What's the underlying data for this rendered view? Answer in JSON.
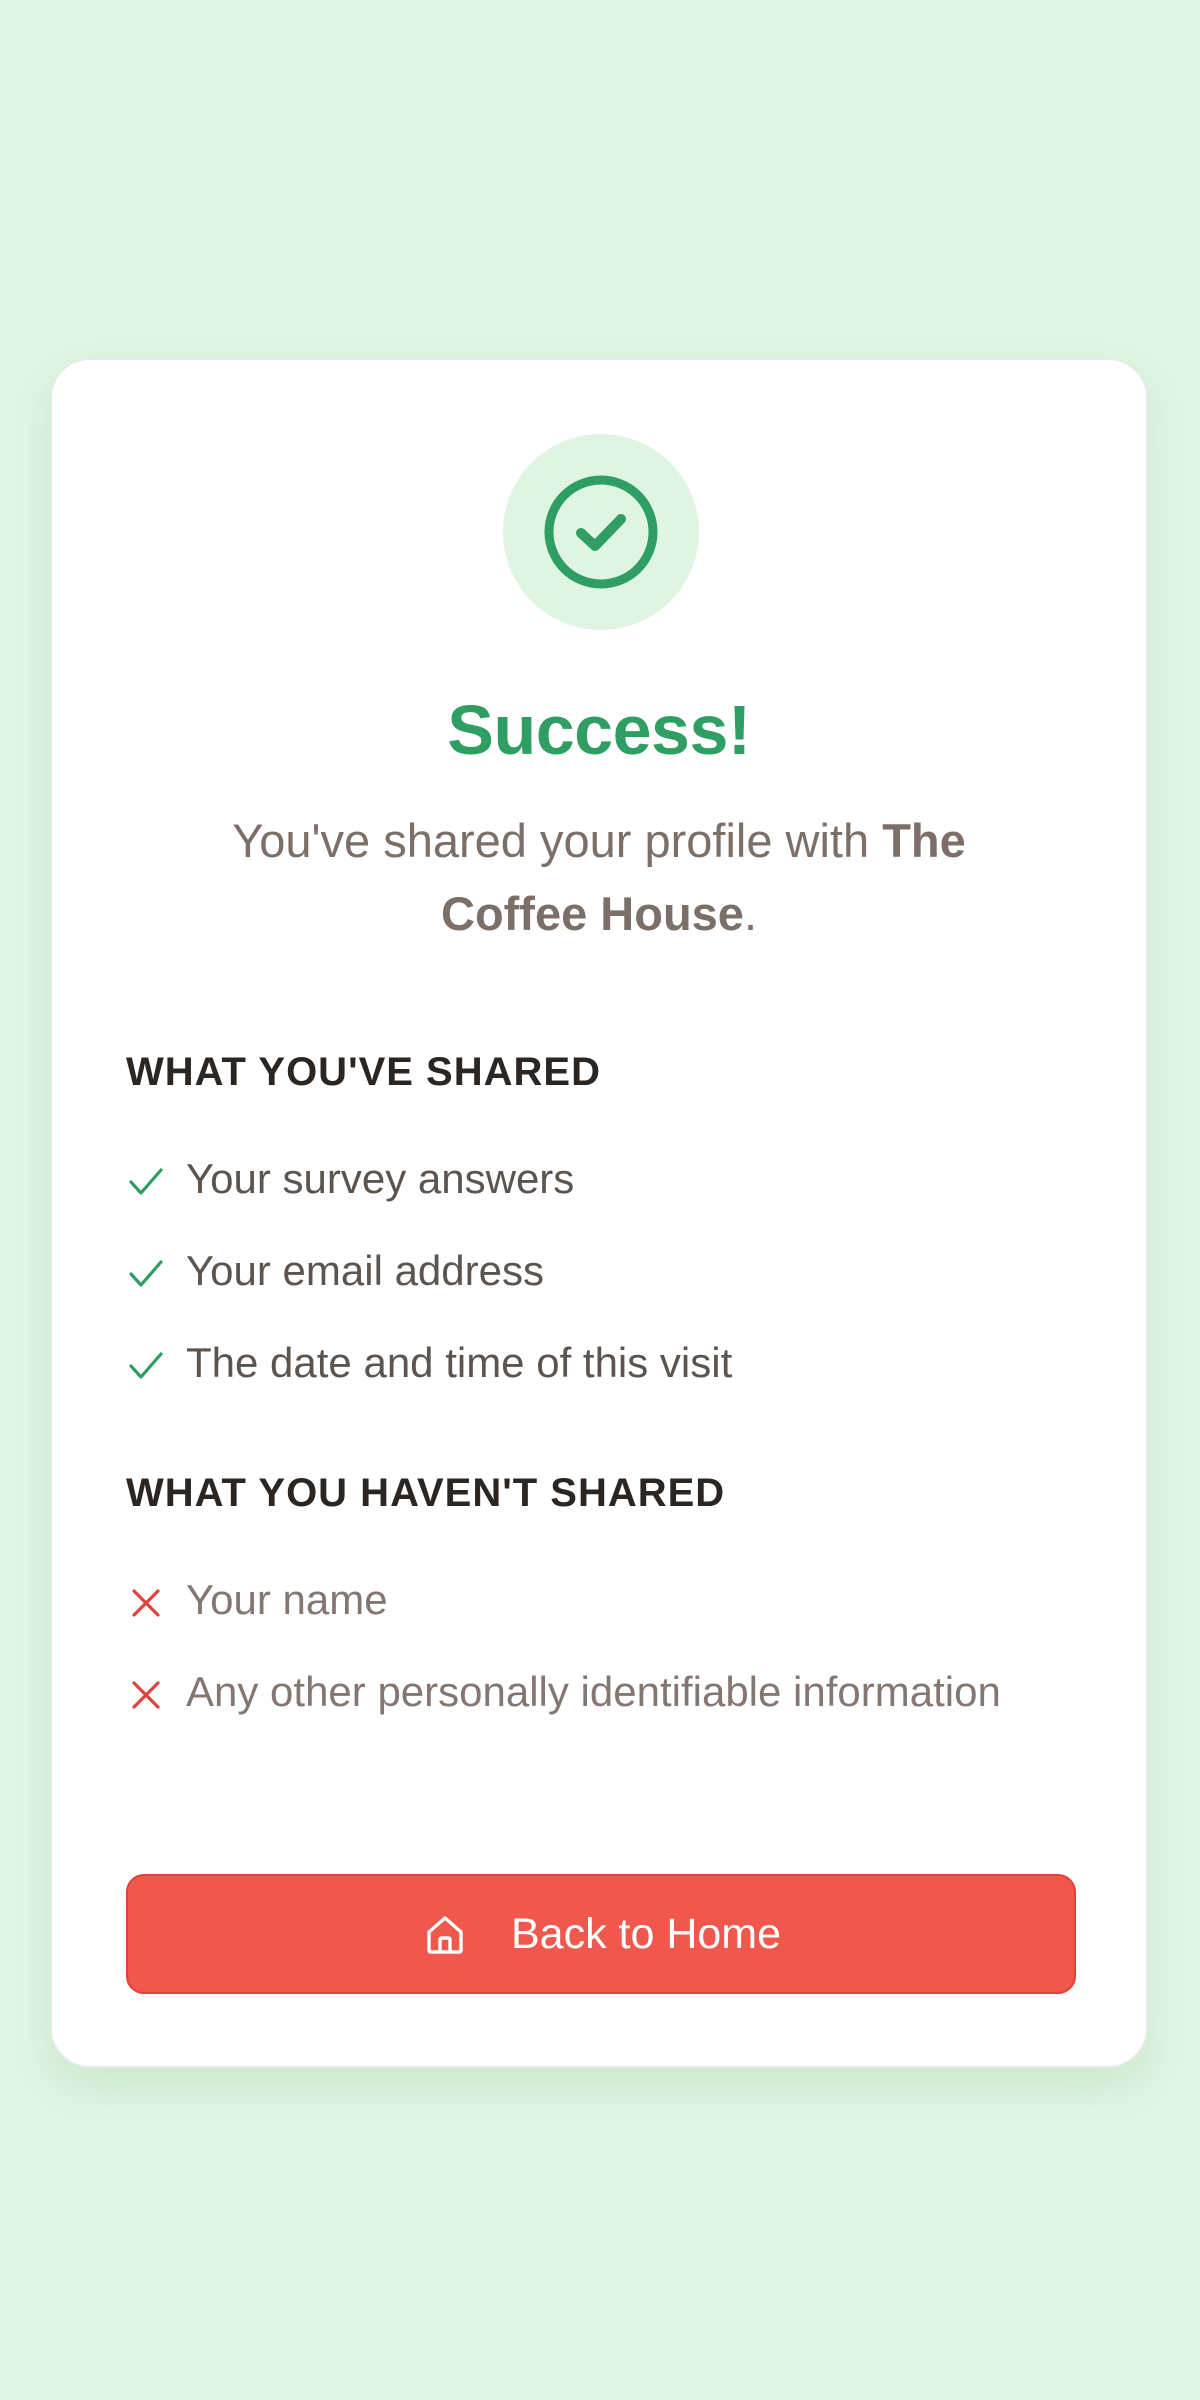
{
  "header": {
    "title": "Success!",
    "subtitle_prefix": "You've shared your profile with ",
    "business_name": "The Coffee House",
    "subtitle_suffix": "."
  },
  "shared": {
    "heading": "WHAT YOU'VE SHARED",
    "items": [
      "Your survey answers",
      "Your email address",
      "The date and time of this visit"
    ]
  },
  "not_shared": {
    "heading": "WHAT YOU HAVEN'T SHARED",
    "items": [
      "Your name",
      "Any other personally identifiable information"
    ]
  },
  "action": {
    "home_label": "Back to Home"
  },
  "icons": {
    "success": "check-circle-icon",
    "shared_item": "checkmark-icon",
    "not_shared_item": "cross-icon",
    "home": "home-icon"
  },
  "colors": {
    "background": "#dff5e1",
    "success": "#2e9e63",
    "check": "#2e9e63",
    "cross": "#e0413a",
    "button": "#f0584e"
  }
}
